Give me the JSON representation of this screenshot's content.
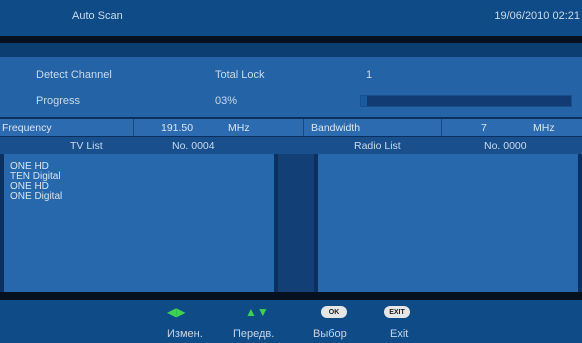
{
  "header": {
    "title": "Auto Scan",
    "datetime": "19/06/2010 02:21"
  },
  "status": {
    "detect_label": "Detect Channel",
    "total_lock_label": "Total Lock",
    "total_lock_value": "1",
    "progress_label": "Progress",
    "progress_value": "03%",
    "progress_fraction": 0.03
  },
  "frequency": {
    "label": "Frequency",
    "value": "191.50",
    "unit": "MHz",
    "bandwidth_label": "Bandwidth",
    "bandwidth_value": "7",
    "bandwidth_unit": "MHz"
  },
  "lists": {
    "tv_label": "TV List",
    "tv_count": "No. 0004",
    "radio_label": "Radio List",
    "radio_count": "No. 0000",
    "tv_channels": [
      "ONE HD",
      "TEN Digital",
      "ONE HD",
      "ONE Digital"
    ]
  },
  "footer": {
    "change_label": "Измен.",
    "move_label": "Передв.",
    "ok_button": "OK",
    "select_label": "Выбор",
    "exit_button": "EXIT",
    "exit_label": "Exit"
  }
}
